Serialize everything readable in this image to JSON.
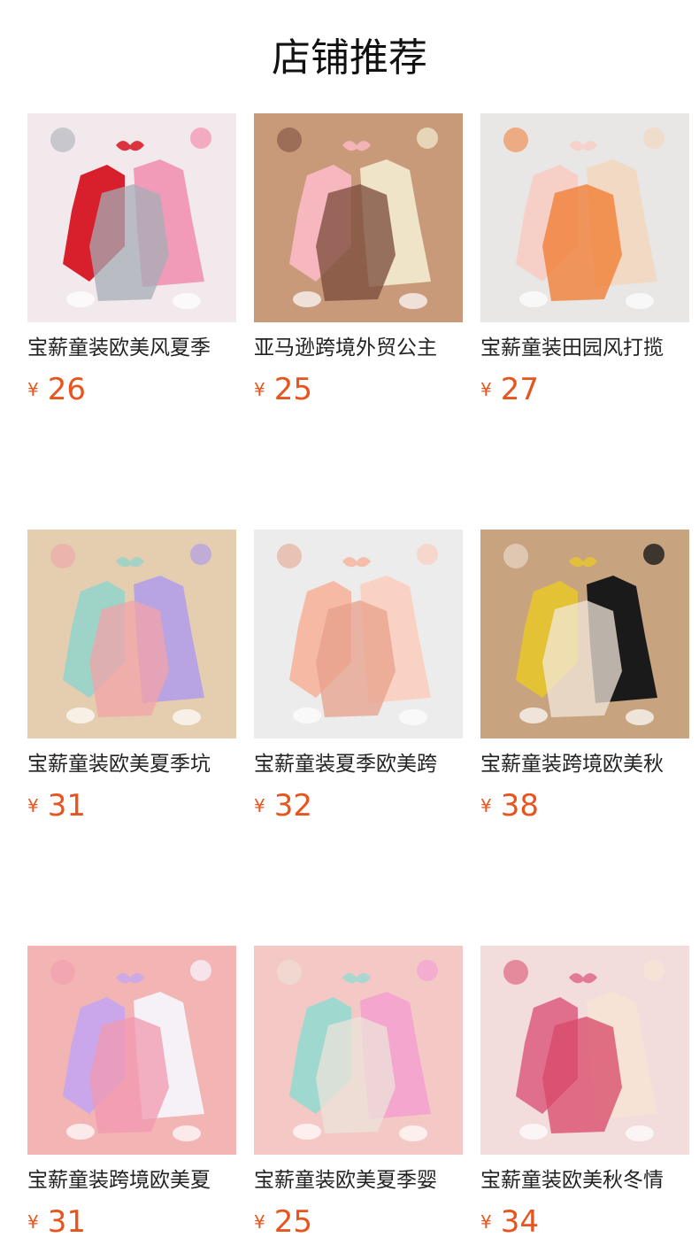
{
  "header": {
    "title": "店铺推荐"
  },
  "products": [
    {
      "name": "宝薪童装欧美风夏季",
      "currency": "¥",
      "price": "26",
      "image_icon": "baby-romper-set-image",
      "colors": {
        "bg": "#f2e9ec",
        "primary": "#d8202c",
        "secondary": "#f29bb8",
        "tertiary": "#a6acb5"
      }
    },
    {
      "name": "亚马逊跨境外贸公主",
      "currency": "¥",
      "price": "25",
      "image_icon": "tutu-dress-image",
      "colors": {
        "bg": "#c89a7a",
        "primary": "#f7b7bf",
        "secondary": "#efe3c8",
        "tertiary": "#7a4a3a"
      }
    },
    {
      "name": "宝薪童装田园风打揽",
      "currency": "¥",
      "price": "27",
      "image_icon": "floral-tutu-romper-image",
      "colors": {
        "bg": "#e9e7e6",
        "primary": "#f6cfc6",
        "secondary": "#f1d9c4",
        "tertiary": "#f07a2e"
      }
    },
    {
      "name": "宝薪童装欧美夏季坑",
      "currency": "¥",
      "price": "31",
      "image_icon": "daisy-overalls-image",
      "colors": {
        "bg": "#e5cdb0",
        "primary": "#9ed3c8",
        "secondary": "#b8a4e2",
        "tertiary": "#f3a3a8"
      }
    },
    {
      "name": "宝薪童装夏季欧美跨",
      "currency": "¥",
      "price": "32",
      "image_icon": "lace-bow-dress-image",
      "colors": {
        "bg": "#ececec",
        "primary": "#f5b9a4",
        "secondary": "#f9d2c4",
        "tertiary": "#e7a08b"
      }
    },
    {
      "name": "宝薪童装跨境欧美秋",
      "currency": "¥",
      "price": "38",
      "image_icon": "plaid-pinafore-image",
      "colors": {
        "bg": "#c8a380",
        "primary": "#e4c235",
        "secondary": "#1a1a1a",
        "tertiary": "#f2e7da"
      }
    },
    {
      "name": "宝薪童装跨境欧美夏",
      "currency": "¥",
      "price": "31",
      "image_icon": "tulle-party-dress-image",
      "colors": {
        "bg": "#f3b4b4",
        "primary": "#c9a7ea",
        "secondary": "#f6f0f7",
        "tertiary": "#f19ab0"
      }
    },
    {
      "name": "宝薪童装欧美夏季婴",
      "currency": "¥",
      "price": "25",
      "image_icon": "floral-smock-dress-image",
      "colors": {
        "bg": "#f4c9c5",
        "primary": "#9fd8cf",
        "secondary": "#f4a6cf",
        "tertiary": "#ece3da"
      }
    },
    {
      "name": "宝薪童装欧美秋冬情",
      "currency": "¥",
      "price": "34",
      "image_icon": "heart-footie-pajamas-image",
      "colors": {
        "bg": "#f2dcdc",
        "primary": "#e06f8e",
        "secondary": "#f6e3d6",
        "tertiary": "#d84767"
      }
    }
  ]
}
